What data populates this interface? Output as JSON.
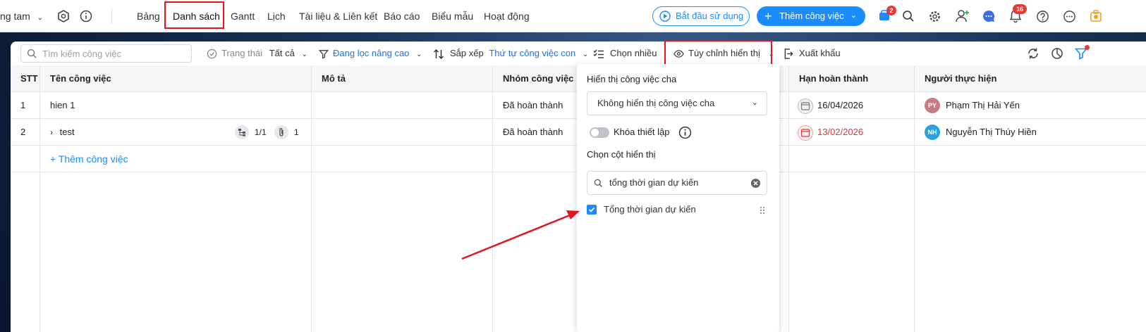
{
  "topbar": {
    "project_name": "ng tam",
    "tabs": [
      "Bảng",
      "Danh sách",
      "Gantt",
      "Lịch",
      "Tài liệu & Liên kết",
      "Báo cáo",
      "Biểu mẫu",
      "Hoạt động"
    ],
    "active_tab": "Danh sách",
    "start_button": "Bắt đầu sử dụng",
    "add_task_button": "Thêm công việc",
    "cart_badge": "2",
    "bell_badge": "16"
  },
  "toolbar": {
    "search_placeholder": "Tìm kiếm công việc",
    "status_label": "Trạng thái",
    "status_value": "Tất cả",
    "filter_label": "Đang lọc nâng cao",
    "sort_label": "Sắp xếp",
    "sort_value": "Thứ tự công việc con",
    "multi_select": "Chọn nhiều",
    "customize": "Tùy chỉnh hiển thị",
    "export": "Xuất khẩu"
  },
  "table": {
    "headers": {
      "stt": "STT",
      "name": "Tên công việc",
      "desc": "Mô tả",
      "group": "Nhóm công việc",
      "due": "Hạn hoàn thành",
      "assignee": "Người thực hiện"
    },
    "rows": [
      {
        "stt": "1",
        "name": "hien 1",
        "group": "Đã hoàn thành",
        "due": "16/04/2026",
        "assignee": "Phạm Thị Hải Yến",
        "initials": "PY"
      },
      {
        "stt": "2",
        "name": "test",
        "subtasks": "1/1",
        "attachments": "1",
        "group": "Đã hoàn thành",
        "due": "13/02/2026",
        "assignee": "Nguyễn Thị Thúy Hiền",
        "initials": "NH"
      }
    ],
    "add_task": "+ Thêm công việc"
  },
  "dropdown": {
    "parent_title": "Hiển thị công việc cha",
    "parent_select": "Không hiển thị công việc cha",
    "lock_label": "Khóa thiết lập",
    "columns_title": "Chọn cột hiển thị",
    "column_search_value": "tổng thời gian dự kiến",
    "column_option": "Tổng thời gian dự kiến",
    "column_option_checked": true
  },
  "colors": {
    "accent": "#1a8cff",
    "overdue": "#d9363e",
    "annotation": "#e0161c"
  }
}
